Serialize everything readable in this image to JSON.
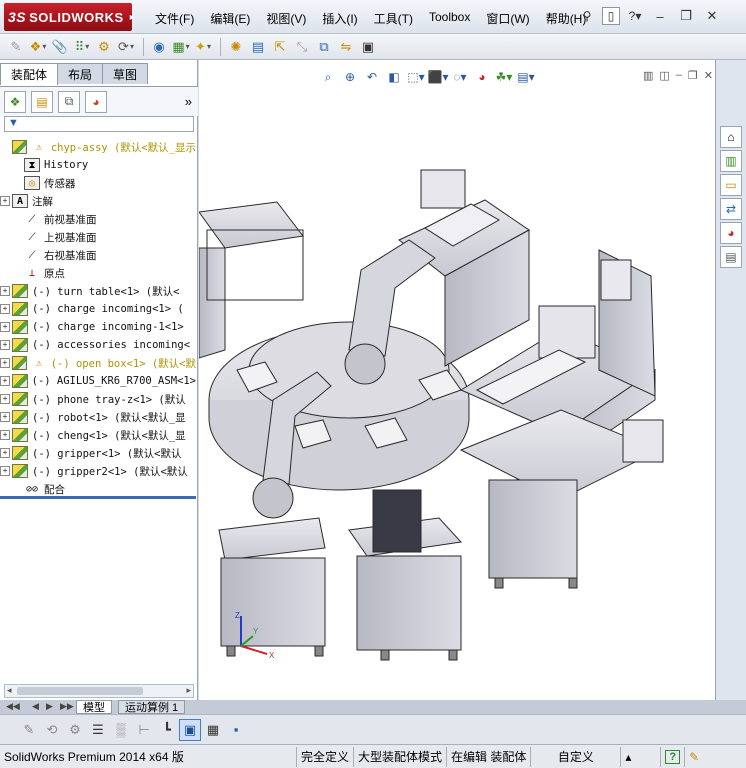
{
  "app": {
    "brand_prefix": "3S",
    "brand_name": "SOLIDWORKS"
  },
  "menu": [
    "文件(F)",
    "编辑(E)",
    "视图(V)",
    "插入(I)",
    "工具(T)",
    "Toolbox",
    "窗口(W)",
    "帮助(H)"
  ],
  "pane": {
    "tabs": [
      "装配体",
      "布局",
      "草图"
    ],
    "more_glyph": "»"
  },
  "tree": [
    {
      "label": "chyp-assy  (默认<默认_显示",
      "icon": "assembly-icon",
      "expander": "",
      "warn": true,
      "yellow": true
    },
    {
      "label": "History",
      "icon": "history-icon",
      "expander": "",
      "indent": 1
    },
    {
      "label": "传感器",
      "icon": "sensor-icon",
      "expander": "",
      "indent": 1
    },
    {
      "label": "注解",
      "icon": "annotation-icon",
      "expander": "+",
      "indent": 1
    },
    {
      "label": "前视基准面",
      "icon": "plane-icon",
      "expander": "",
      "indent": 1
    },
    {
      "label": "上视基准面",
      "icon": "plane-icon",
      "expander": "",
      "indent": 1
    },
    {
      "label": "右视基准面",
      "icon": "plane-icon",
      "expander": "",
      "indent": 1
    },
    {
      "label": "原点",
      "icon": "origin-icon",
      "expander": "",
      "indent": 1
    },
    {
      "label": "(-) turn table<1> (默认<",
      "icon": "assembly-icon",
      "expander": "+"
    },
    {
      "label": "(-) charge incoming<1> (",
      "icon": "assembly-icon",
      "expander": "+"
    },
    {
      "label": "(-) charge incoming-1<1>",
      "icon": "assembly-icon",
      "expander": "+"
    },
    {
      "label": "(-) accessories incoming<",
      "icon": "assembly-icon",
      "expander": "+"
    },
    {
      "label": "(-) open box<1> (默认<默",
      "icon": "assembly-icon",
      "expander": "+",
      "warn": true,
      "yellow": true
    },
    {
      "label": "(-) AGILUS_KR6_R700_ASM<1>",
      "icon": "assembly-icon",
      "expander": "+"
    },
    {
      "label": "(-) phone tray-z<1> (默认",
      "icon": "assembly-icon",
      "expander": "+"
    },
    {
      "label": "(-) robot<1> (默认<默认_显",
      "icon": "assembly-icon",
      "expander": "+"
    },
    {
      "label": "(-) cheng<1> (默认<默认_显",
      "icon": "assembly-icon",
      "expander": "+"
    },
    {
      "label": "(-) gripper<1> (默认<默认",
      "icon": "assembly-icon",
      "expander": "+"
    },
    {
      "label": "(-) gripper2<1> (默认<默认",
      "icon": "assembly-icon",
      "expander": "+"
    },
    {
      "label": "配合",
      "icon": "mates-icon",
      "expander": ""
    }
  ],
  "bottom_tabs": [
    "模型",
    "运动算例 1"
  ],
  "status": {
    "product": "SolidWorks Premium 2014 x64 版",
    "fully_defined": "完全定义",
    "large_assembly": "大型装配体模式",
    "editing": "在编辑 装配体",
    "units": "自定义",
    "help": "?"
  },
  "colors": {
    "brand_red": "#b0121c",
    "tree_warning_yellow": "#b09400",
    "selection_blue": "#3c6ab8"
  }
}
